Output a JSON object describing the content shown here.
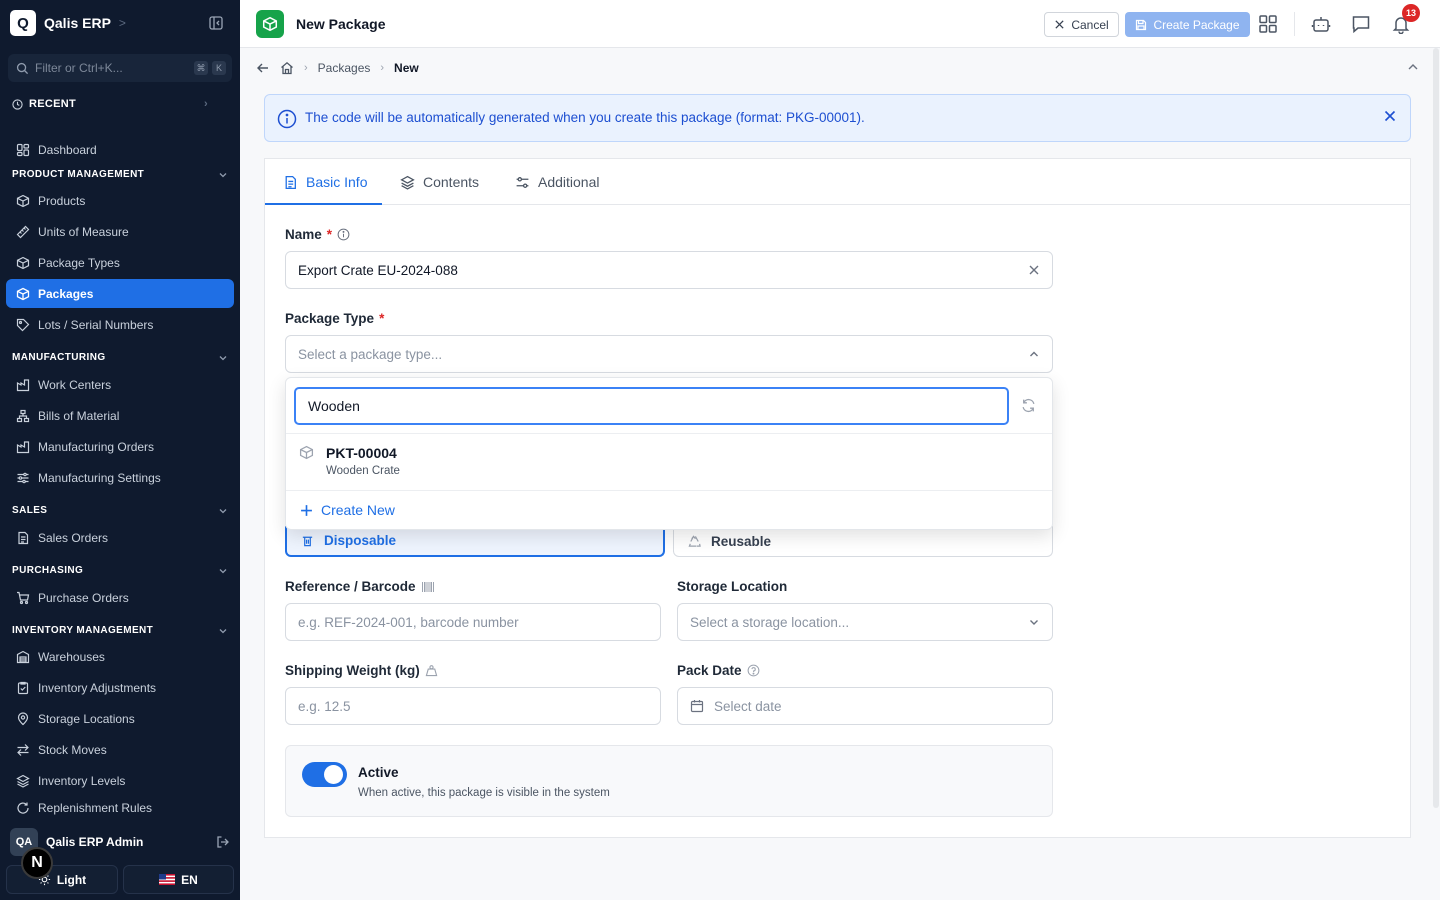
{
  "sidebar": {
    "brand_letter": "Q",
    "brand_name": "Qalis ERP",
    "filter_placeholder": "Filter or Ctrl+K...",
    "kbd": [
      "⌘",
      "K"
    ],
    "recent_label": "RECENT",
    "dashboard": "Dashboard",
    "sections": {
      "product": "PRODUCT MANAGEMENT",
      "manufacturing": "MANUFACTURING",
      "sales": "SALES",
      "purchasing": "PURCHASING",
      "inventory": "INVENTORY MANAGEMENT"
    },
    "product_items": [
      "Products",
      "Units of Measure",
      "Package Types",
      "Packages",
      "Lots / Serial Numbers"
    ],
    "manufacturing_items": [
      "Work Centers",
      "Bills of Material",
      "Manufacturing Orders",
      "Manufacturing Settings"
    ],
    "sales_items": [
      "Sales Orders"
    ],
    "purchasing_items": [
      "Purchase Orders"
    ],
    "inventory_items": [
      "Warehouses",
      "Inventory Adjustments",
      "Storage Locations",
      "Stock Moves",
      "Inventory Levels",
      "Replenishment Rules"
    ],
    "user_initials": "QA",
    "user_name": "Qalis ERP Admin",
    "theme_label": "Light",
    "lang_label": "EN",
    "n_badge": "N"
  },
  "header": {
    "title": "New Package",
    "cancel_label": "Cancel",
    "create_label": "Create Package",
    "notification_count": "13"
  },
  "breadcrumb": {
    "items": [
      "Packages",
      "New"
    ]
  },
  "banner": {
    "text": "The code will be automatically generated when you create this package (format: PKG-00001)."
  },
  "tabs": [
    "Basic Info",
    "Contents",
    "Additional"
  ],
  "form": {
    "name_label": "Name",
    "name_value": "Export Crate EU-2024-088",
    "package_type_label": "Package Type",
    "package_type_placeholder": "Select a package type...",
    "disposable_label": "Disposable",
    "reusable_label": "Reusable",
    "reference_label": "Reference / Barcode",
    "reference_placeholder": "e.g. REF-2024-001, barcode number",
    "storage_label": "Storage Location",
    "storage_placeholder": "Select a storage location...",
    "weight_label": "Shipping Weight (kg)",
    "weight_placeholder": "e.g. 12.5",
    "pack_date_label": "Pack Date",
    "pack_date_placeholder": "Select date",
    "active_title": "Active",
    "active_desc": "When active, this package is visible in the system"
  },
  "dropdown": {
    "search_value": "Wooden",
    "option_code": "PKT-00004",
    "option_name": "Wooden Crate",
    "create_new_label": "Create New"
  },
  "colors": {
    "accent": "#1f6fe5",
    "sidebar_bg": "#0f1a2e",
    "page_icon": "#16a34a",
    "danger": "#dc2626"
  }
}
